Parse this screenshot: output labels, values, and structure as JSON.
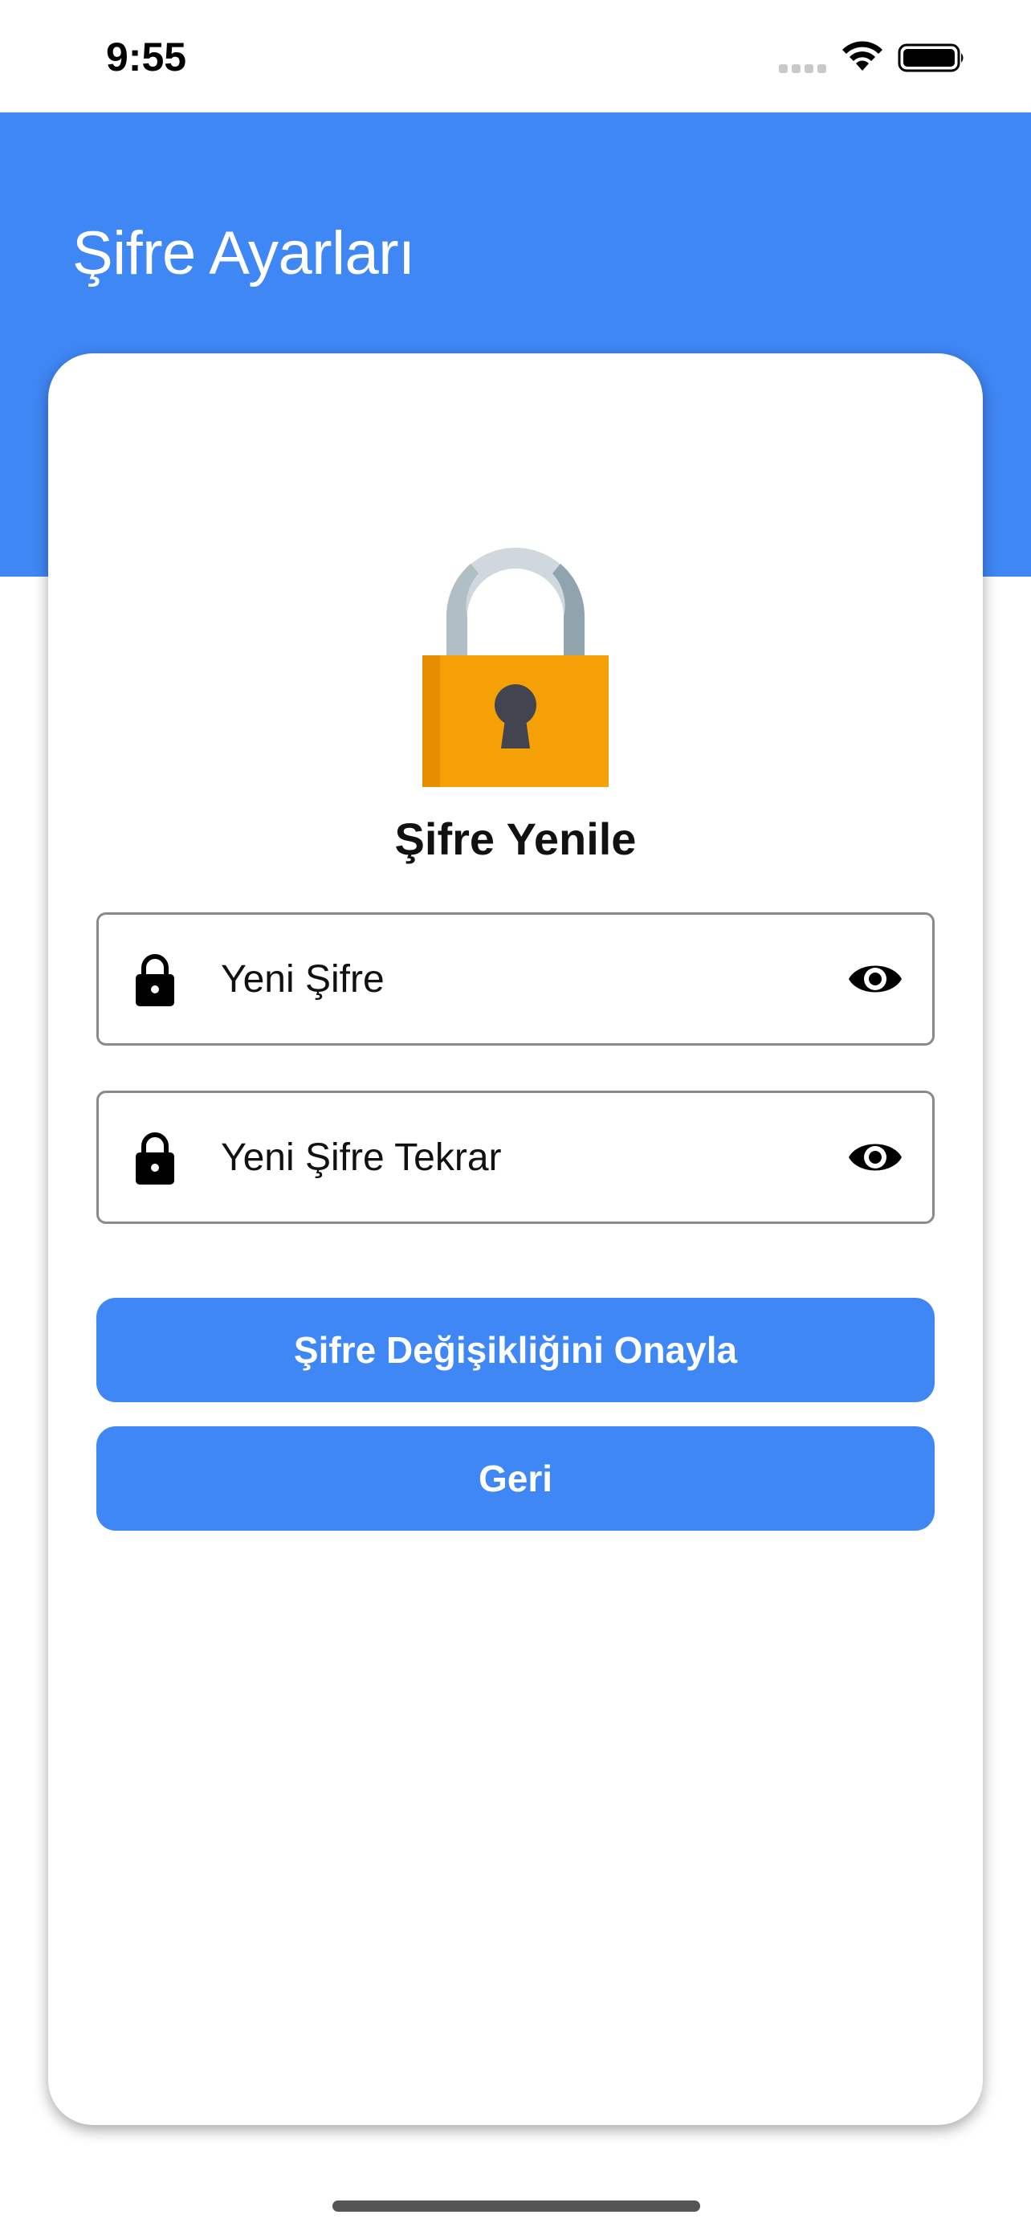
{
  "status_bar": {
    "time": "9:55"
  },
  "header": {
    "title": "Şifre Ayarları"
  },
  "card": {
    "title": "Şifre Yenile",
    "fields": [
      {
        "placeholder": "Yeni Şifre",
        "value": ""
      },
      {
        "placeholder": "Yeni Şifre Tekrar",
        "value": ""
      }
    ],
    "buttons": {
      "confirm_label": "Şifre Değişikliğini Onayla",
      "back_label": "Geri"
    }
  },
  "colors": {
    "primary": "#3f87f5",
    "lock_body": "#f5a004",
    "lock_shackle": "#cfd8dc"
  },
  "icons": {
    "header_illustration": "padlock-icon",
    "field_icon": "lock-icon",
    "visibility_toggle": "eye-icon"
  }
}
